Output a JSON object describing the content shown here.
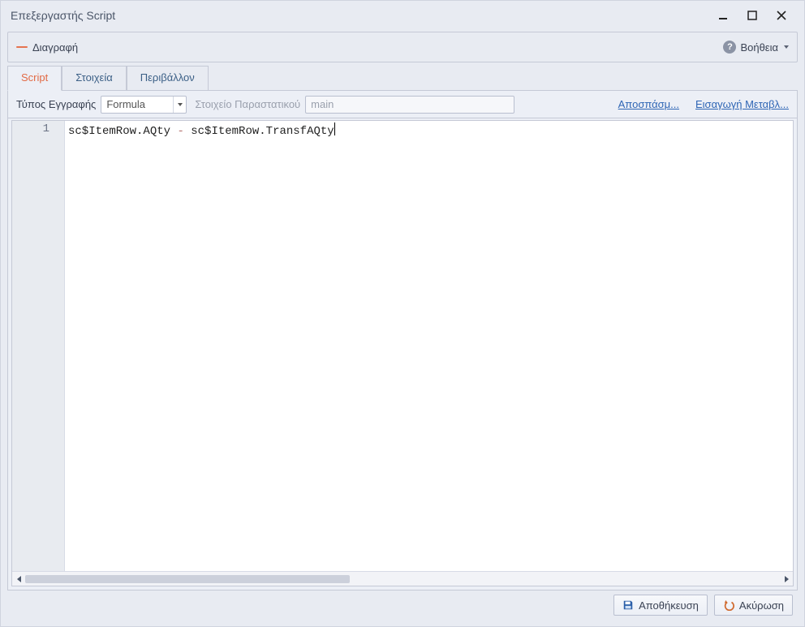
{
  "window": {
    "title": "Επεξεργαστής Script"
  },
  "toolbar": {
    "delete_label": "Διαγραφή",
    "help_label": "Βοήθεια"
  },
  "tabs": [
    {
      "label": "Script",
      "active": true
    },
    {
      "label": "Στοιχεία",
      "active": false
    },
    {
      "label": "Περιβάλλον",
      "active": false
    }
  ],
  "form": {
    "record_type_label": "Τύπος Εγγραφής",
    "record_type_value": "Formula",
    "doc_item_label": "Στοιχείο Παραστατικού",
    "doc_item_value": "main",
    "link_snippet": "Αποσπάσμ...",
    "link_insert_var": "Εισαγωγή Μεταβλ..."
  },
  "code": {
    "line_number": "1",
    "t1": "sc$ItemRow",
    "dot1": ".",
    "t2": "AQty",
    "sp1": " ",
    "op": "-",
    "sp2": " ",
    "t3": "sc$ItemRow",
    "dot2": ".",
    "t4": "TransfAQty"
  },
  "footer": {
    "save": "Αποθήκευση",
    "cancel": "Ακύρωση"
  }
}
